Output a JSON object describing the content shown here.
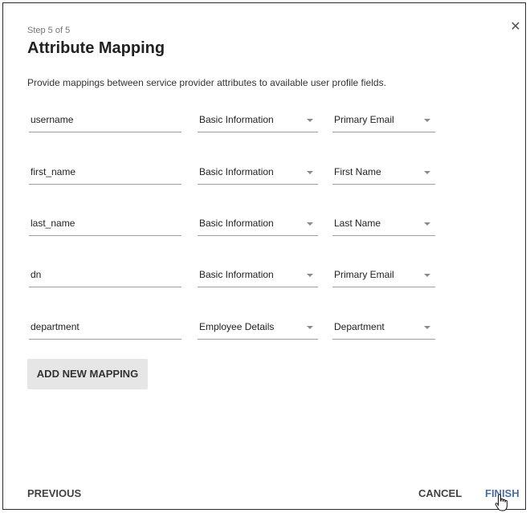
{
  "dialog": {
    "step_label": "Step 5 of 5",
    "title": "Attribute Mapping",
    "close_icon": "close-icon",
    "description": "Provide mappings between service provider attributes to available user profile fields."
  },
  "mappings": [
    {
      "attribute": "username",
      "category": "Basic Information",
      "field": "Primary Email"
    },
    {
      "attribute": "first_name",
      "category": "Basic Information",
      "field": "First Name"
    },
    {
      "attribute": "last_name",
      "category": "Basic Information",
      "field": "Last Name"
    },
    {
      "attribute": "dn",
      "category": "Basic Information",
      "field": "Primary Email"
    },
    {
      "attribute": "department",
      "category": "Employee Details",
      "field": "Department"
    }
  ],
  "actions": {
    "add_mapping": "ADD NEW MAPPING",
    "previous": "PREVIOUS",
    "cancel": "CANCEL",
    "finish": "FINISH"
  },
  "colors": {
    "accent": "#4a6fa5",
    "button_bg": "#e6e6e6"
  }
}
